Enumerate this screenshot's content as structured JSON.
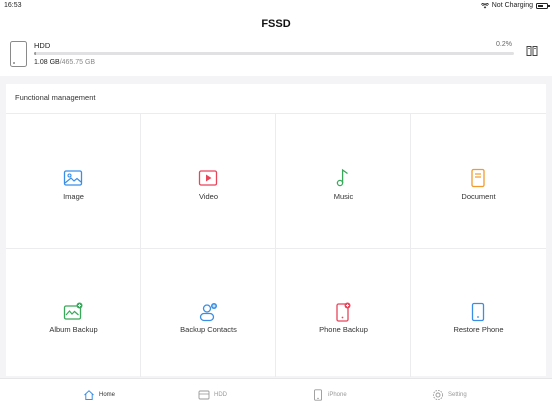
{
  "status": {
    "time": "16:53",
    "charging": "Not Charging",
    "battery_level": 0.6
  },
  "nav": {
    "title": "FSSD"
  },
  "drive": {
    "name": "HDD",
    "percent_label": "0.2%",
    "used": "1.08 GB",
    "total": "/465.75 GB",
    "usage_fraction": 0.002
  },
  "functional": {
    "title": "Functional management",
    "items": [
      {
        "label": "Image",
        "icon": "image-icon",
        "color": "#3a8ee6"
      },
      {
        "label": "Video",
        "icon": "video-icon",
        "color": "#e8455a"
      },
      {
        "label": "Music",
        "icon": "music-icon",
        "color": "#3aa85a"
      },
      {
        "label": "Document",
        "icon": "document-icon",
        "color": "#f29a2e"
      },
      {
        "label": "Album Backup",
        "icon": "album-backup-icon",
        "color": "#3aa85a"
      },
      {
        "label": "Backup Contacts",
        "icon": "backup-contacts-icon",
        "color": "#3a8ee6"
      },
      {
        "label": "Phone Backup",
        "icon": "phone-backup-icon",
        "color": "#e8455a"
      },
      {
        "label": "Restore Phone",
        "icon": "restore-phone-icon",
        "color": "#3a8ee6"
      }
    ]
  },
  "tabs": [
    {
      "label": "Home",
      "icon": "home-icon",
      "active": true
    },
    {
      "label": "HDD",
      "icon": "hdd-icon",
      "active": false
    },
    {
      "label": "iPhone",
      "icon": "iphone-icon",
      "active": false
    },
    {
      "label": "Setting",
      "icon": "gear-icon",
      "active": false
    }
  ]
}
